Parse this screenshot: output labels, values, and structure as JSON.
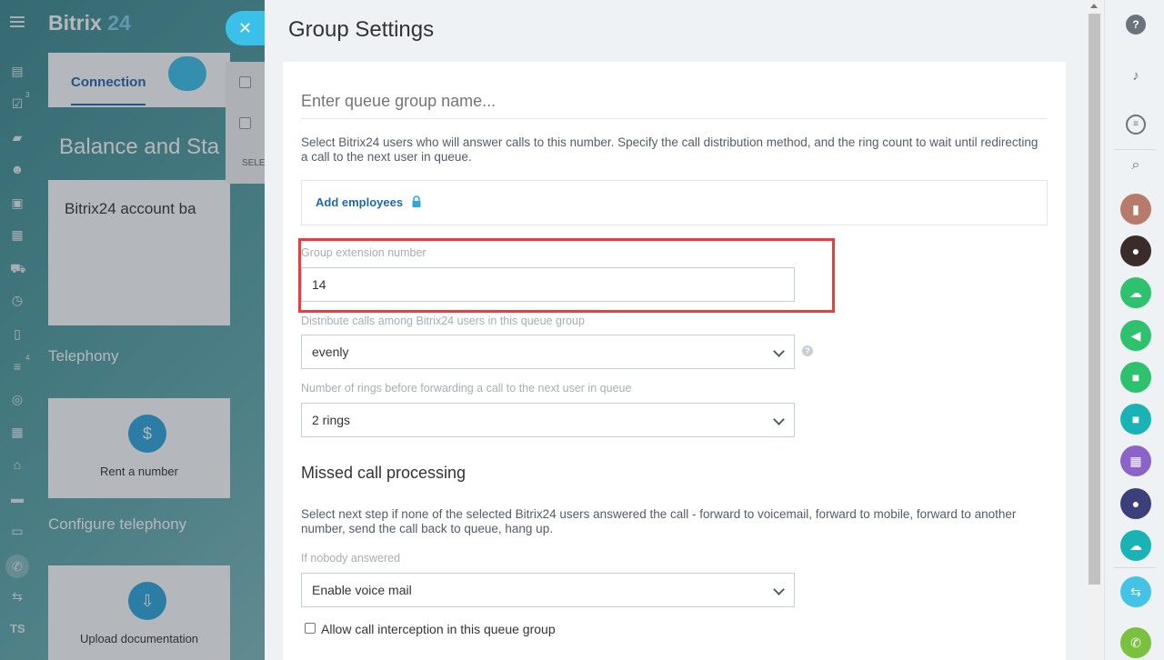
{
  "app": {
    "logo_main": "Bitrix",
    "logo_num": "24"
  },
  "background": {
    "tab_connection": "Connection",
    "page_title": "Balance and Sta",
    "account_label": "Bitrix24 account ba",
    "section_telephony": "Telephony",
    "tile_rent_number": "Rent a number",
    "section_configure": "Configure telephony",
    "tile_upload": "Upload documentation",
    "sidebar_counts": {
      "tasks": "3",
      "filter": "4"
    },
    "sidebar_bottom_text": "TS",
    "table_select_label": "SELE"
  },
  "panel": {
    "title": "Group Settings",
    "close_glyph": "✕",
    "name_placeholder": "Enter queue group name...",
    "users_description": "Select Bitrix24 users who will answer calls to this number. Specify the call distribution method, and the ring count to wait until redirecting a call to the next user in queue.",
    "add_employees": "Add employees",
    "extension_label": "Group extension number",
    "extension_value": "14",
    "distribute_label": "Distribute calls among Bitrix24 users in this queue group",
    "distribute_value": "evenly",
    "rings_label": "Number of rings before forwarding a call to the next user in queue",
    "rings_value": "2 rings",
    "missed_heading": "Missed call processing",
    "missed_description": "Select next step if none of the selected Bitrix24 users answered the call - forward to voicemail, forward to mobile, forward to another number, send the call back to queue, hang up.",
    "nobody_label": "If nobody answered",
    "nobody_value": "Enable voice mail",
    "interception_label": "Allow call interception in this queue group",
    "interception_checked": false,
    "help_glyph": "?"
  },
  "colors": {
    "accent": "#2067b0",
    "highlight": "#ef3b3b",
    "close_button": "#3bc0ea",
    "green": "#2fc26e"
  },
  "rightbar": {
    "icons": [
      "help-icon",
      "bell-icon",
      "chat-icon",
      "search-icon",
      "lock-icon",
      "user-avatar",
      "cloud-icon",
      "megaphone-icon",
      "video-icon",
      "video-icon",
      "calendar-icon",
      "user-avatar",
      "cloud-icon",
      "phone-transfer-icon",
      "phone-icon"
    ]
  }
}
